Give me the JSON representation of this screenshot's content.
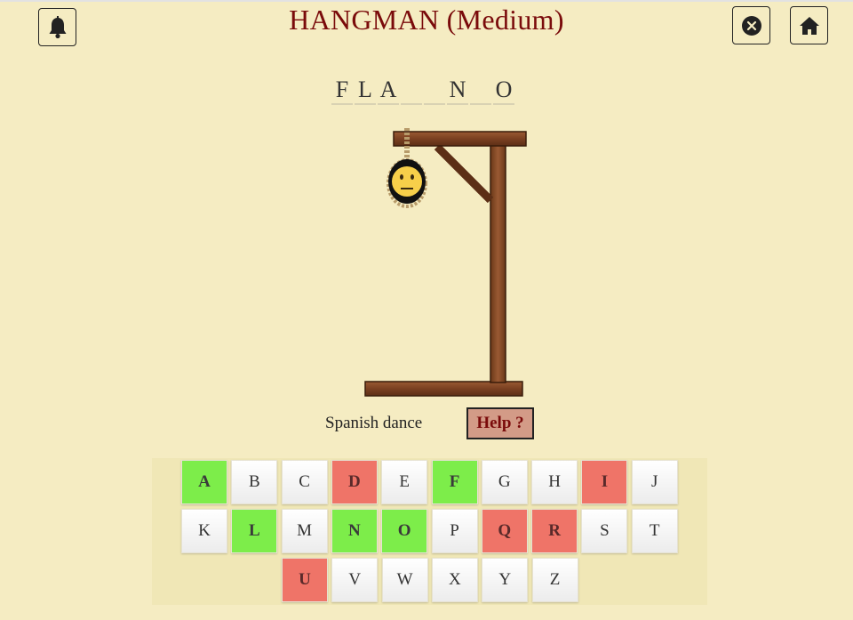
{
  "header": {
    "title": "HANGMAN (Medium)",
    "notification_icon": "bell-icon",
    "close_icon": "close-circle-icon",
    "home_icon": "home-icon"
  },
  "word": {
    "slots": [
      "F",
      "L",
      "A",
      "",
      "",
      "N",
      "",
      "O"
    ]
  },
  "hangman": {
    "parts_shown": [
      "head"
    ],
    "face": "neutral-face"
  },
  "clue": {
    "text": "Spanish dance"
  },
  "help": {
    "label": "Help ?"
  },
  "keyboard": {
    "rows": [
      [
        {
          "letter": "A",
          "state": "correct"
        },
        {
          "letter": "B",
          "state": "unused"
        },
        {
          "letter": "C",
          "state": "unused"
        },
        {
          "letter": "D",
          "state": "wrong"
        },
        {
          "letter": "E",
          "state": "unused"
        },
        {
          "letter": "F",
          "state": "correct"
        },
        {
          "letter": "G",
          "state": "unused"
        },
        {
          "letter": "H",
          "state": "unused"
        },
        {
          "letter": "I",
          "state": "wrong"
        },
        {
          "letter": "J",
          "state": "unused"
        }
      ],
      [
        {
          "letter": "K",
          "state": "unused"
        },
        {
          "letter": "L",
          "state": "correct"
        },
        {
          "letter": "M",
          "state": "unused"
        },
        {
          "letter": "N",
          "state": "correct"
        },
        {
          "letter": "O",
          "state": "correct"
        },
        {
          "letter": "P",
          "state": "unused"
        },
        {
          "letter": "Q",
          "state": "wrong"
        },
        {
          "letter": "R",
          "state": "wrong"
        },
        {
          "letter": "S",
          "state": "unused"
        },
        {
          "letter": "T",
          "state": "unused"
        }
      ],
      [
        {
          "letter": "U",
          "state": "wrong"
        },
        {
          "letter": "V",
          "state": "unused"
        },
        {
          "letter": "W",
          "state": "unused"
        },
        {
          "letter": "X",
          "state": "unused"
        },
        {
          "letter": "Y",
          "state": "unused"
        },
        {
          "letter": "Z",
          "state": "unused"
        }
      ]
    ]
  },
  "colors": {
    "background": "#f5ecc2",
    "title": "#7a0b0b",
    "correct": "#7ded4a",
    "wrong": "#ef7468",
    "help_bg": "#d39b87"
  }
}
